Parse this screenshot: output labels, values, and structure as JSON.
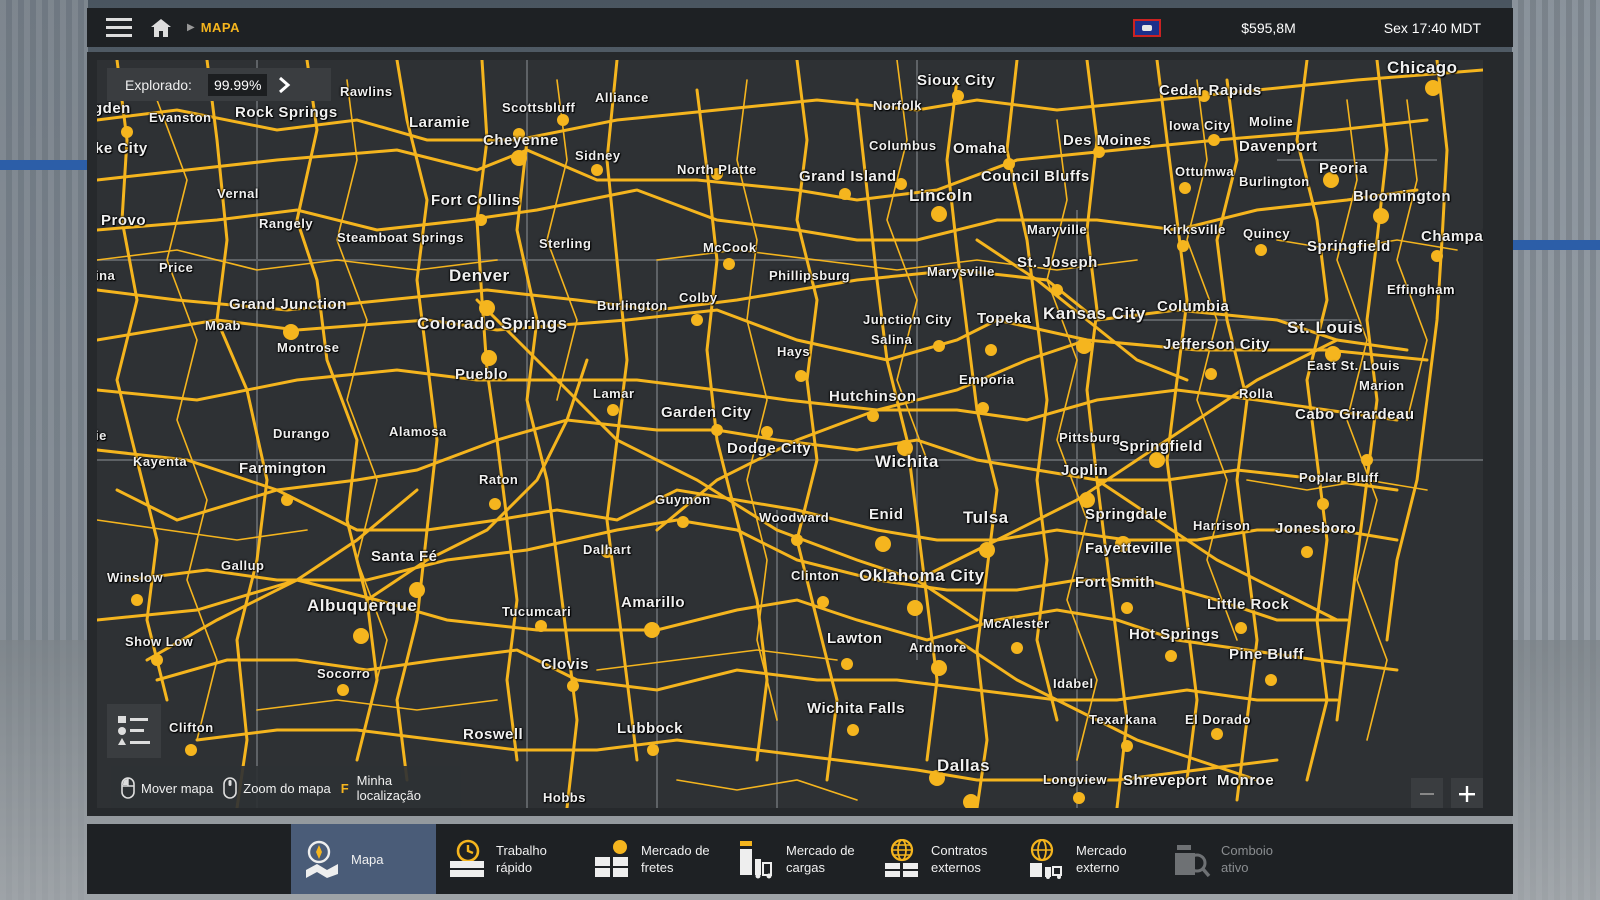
{
  "topbar": {
    "breadcrumb": "MAPA",
    "money": "$595,8M",
    "clock": "Sex 17:40 MDT"
  },
  "explored": {
    "label": "Explorado:",
    "value": "99.99%"
  },
  "hints": {
    "move": "Mover mapa",
    "zoom": "Zoom do mapa",
    "location_key": "F",
    "location_line1": "Minha",
    "location_line2": "localização"
  },
  "colors": {
    "road": "#f5b51e",
    "accent": "#f5b51e",
    "active_tab": "#4a5c78"
  },
  "map_labels": {
    "chicago": "Chicago",
    "sioux_city": "Sioux City",
    "cedar_rapids": "Cedar Rapids",
    "alliance": "Alliance",
    "rawlins": "Rawlins",
    "scottsbluff": "Scottsbluff",
    "norfolk": "Norfolk",
    "iowa_city": "Iowa City",
    "moline": "Moline",
    "ogden": "gden",
    "evanston": "Evanston",
    "rock_springs": "Rock Springs",
    "laramie": "Laramie",
    "cheyenne": "Cheyenne",
    "columbus": "Columbus",
    "omaha": "Omaha",
    "des_moines": "Des Moines",
    "davenport": "Davenport",
    "salt_lake": "ke City",
    "sidney": "Sidney",
    "north_platte": "North Platte",
    "grand_island": "Grand Island",
    "council_bluffs": "Council Bluffs",
    "ottumwa": "Ottumwa",
    "peoria": "Peoria",
    "burlington_ia": "Burlington",
    "vernal": "Vernal",
    "fort_collins": "Fort Collins",
    "lincoln": "Lincoln",
    "bloomington": "Bloomington",
    "provo": "Provo",
    "rangely": "Rangely",
    "maryville": "Maryville",
    "kirksville": "Kirksville",
    "quincy": "Quincy",
    "steamboat": "Steamboat Springs",
    "sterling": "Sterling",
    "mccook": "McCook",
    "springfield_il": "Springfield",
    "champaign": "Champai",
    "price": "Price",
    "st_joseph": "St. Joseph",
    "marysville": "Marysville",
    "phillipsburg": "Phillipsburg",
    "denver": "Denver",
    "ina": "ina",
    "effingham": "Effingham",
    "colby": "Colby",
    "grand_junction": "Grand Junction",
    "burlington_co": "Burlington",
    "columbia": "Columbia",
    "moab": "Moab",
    "colorado_springs": "Colorado Springs",
    "junction_city": "Junction City",
    "topeka": "Topeka",
    "kansas_city": "Kansas City",
    "st_louis": "St. Louis",
    "montrose": "Montrose",
    "salina": "Salina",
    "jefferson_city": "Jefferson City",
    "hays": "Hays",
    "east_st_louis": "East St. Louis",
    "pueblo": "Pueblo",
    "emporia": "Emporia",
    "marion": "Marion",
    "lamar": "Lamar",
    "hutchinson": "Hutchinson",
    "rolla": "Rolla",
    "garden_city": "Garden City",
    "cabo_girardeau": "Cabo Girardeau",
    "durango": "Durango",
    "alamosa": "Alamosa",
    "pittsburg": "Pittsburg",
    "ie": "ie",
    "springfield_mo": "Springfield",
    "dodge_city": "Dodge City",
    "kayenta": "Kayenta",
    "wichita": "Wichita",
    "farmington": "Farmington",
    "joplin": "Joplin",
    "poplar_bluff": "Poplar Bluff",
    "raton": "Raton",
    "guymon": "Guymon",
    "springdale": "Springdale",
    "woodward": "Woodward",
    "enid": "Enid",
    "tulsa": "Tulsa",
    "harrison": "Harrison",
    "jonesboro": "Jonesboro",
    "dalhart": "Dalhart",
    "fayetteville": "Fayetteville",
    "santa_fe": "Santa Fé",
    "gallup": "Gallup",
    "winslow": "Winslow",
    "clinton": "Clinton",
    "oklahoma_city": "Oklahoma City",
    "fort_smith": "Fort Smith",
    "albuquerque": "Albuquerque",
    "amarillo": "Amarillo",
    "little_rock": "Little Rock",
    "tucumcari": "Tucumcari",
    "mcalester": "McAlester",
    "show_low": "Show Low",
    "lawton": "Lawton",
    "hot_springs": "Hot Springs",
    "ardmore": "Ardmore",
    "pine_bluff": "Pine Bluff",
    "clovis": "Clovis",
    "socorro": "Socorro",
    "idabel": "Idabel",
    "wichita_falls": "Wichita Falls",
    "texarkana": "Texarkana",
    "el_dorado": "El Dorado",
    "clifton": "Clifton",
    "lubbock": "Lubbock",
    "roswell": "Roswell",
    "dallas": "Dallas",
    "longview": "Longview",
    "shreveport": "Shreveport",
    "monroe": "Monroe",
    "hobbs": "Hobbs"
  },
  "bottom_nav": [
    {
      "label1": "Mapa",
      "label2": "",
      "icon": "compass-map-icon"
    },
    {
      "label1": "Trabalho",
      "label2": "rápido",
      "icon": "clock-truck-icon"
    },
    {
      "label1": "Mercado de",
      "label2": "fretes",
      "icon": "freight-market-icon"
    },
    {
      "label1": "Mercado de",
      "label2": "cargas",
      "icon": "cargo-market-icon"
    },
    {
      "label1": "Contratos",
      "label2": "externos",
      "icon": "globe-contracts-icon"
    },
    {
      "label1": "Mercado",
      "label2": "externo",
      "icon": "globe-market-icon"
    },
    {
      "label1": "Comboio",
      "label2": "ativo",
      "icon": "convoy-search-icon"
    }
  ]
}
